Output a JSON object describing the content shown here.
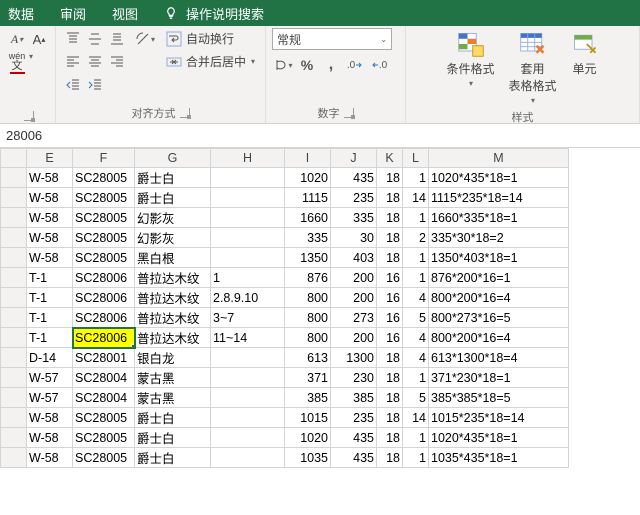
{
  "tabs": {
    "data": "数据",
    "review": "审阅",
    "view": "视图",
    "tell_me": "操作说明搜索"
  },
  "ribbon": {
    "font_size_caret": "▾",
    "btn_italic": "A",
    "btn_wen": "wén",
    "btn_wen_sub": "文",
    "wrap_label": "自动换行",
    "merge_label": "合并后居中",
    "align_group": "对齐方式",
    "number_format": "常规",
    "number_group": "数字",
    "cond_fmt": "条件格式",
    "table_fmt": "套用\n表格格式",
    "cell_style": "单元",
    "styles_group": "样式"
  },
  "formula_bar_value": "28006",
  "columns": [
    "E",
    "F",
    "G",
    "H",
    "I",
    "J",
    "K",
    "L",
    "M"
  ],
  "rows": [
    {
      "e": "W-58",
      "f": "SC28005",
      "g": "爵士白",
      "h": "",
      "i": "1020",
      "j": "435",
      "k": "18",
      "l": "1",
      "m": "1020*435*18=1"
    },
    {
      "e": "W-58",
      "f": "SC28005",
      "g": "爵士白",
      "h": "",
      "i": "1115",
      "j": "235",
      "k": "18",
      "l": "14",
      "m": "1115*235*18=14"
    },
    {
      "e": "W-58",
      "f": "SC28005",
      "g": "幻影灰",
      "h": "",
      "i": "1660",
      "j": "335",
      "k": "18",
      "l": "1",
      "m": "1660*335*18=1"
    },
    {
      "e": "W-58",
      "f": "SC28005",
      "g": "幻影灰",
      "h": "",
      "i": "335",
      "j": "30",
      "k": "18",
      "l": "2",
      "m": "335*30*18=2"
    },
    {
      "e": "W-58",
      "f": "SC28005",
      "g": "黑白根",
      "h": "",
      "i": "1350",
      "j": "403",
      "k": "18",
      "l": "1",
      "m": "1350*403*18=1"
    },
    {
      "e": "T-1",
      "f": "SC28006",
      "g": "普拉达木纹",
      "h": "1",
      "i": "876",
      "j": "200",
      "k": "16",
      "l": "1",
      "m": "876*200*16=1"
    },
    {
      "e": "T-1",
      "f": "SC28006",
      "g": "普拉达木纹",
      "h": "2.8.9.10",
      "i": "800",
      "j": "200",
      "k": "16",
      "l": "4",
      "m": "800*200*16=4"
    },
    {
      "e": "T-1",
      "f": "SC28006",
      "g": "普拉达木纹",
      "h": "3~7",
      "i": "800",
      "j": "273",
      "k": "16",
      "l": "5",
      "m": "800*273*16=5"
    },
    {
      "e": "T-1",
      "f": "SC28006",
      "g": "普拉达木纹",
      "h": "11~14",
      "i": "800",
      "j": "200",
      "k": "16",
      "l": "4",
      "m": "800*200*16=4",
      "hl": true,
      "active": true
    },
    {
      "e": "D-14",
      "f": "SC28001",
      "g": "银白龙",
      "h": "",
      "i": "613",
      "j": "1300",
      "k": "18",
      "l": "4",
      "m": "613*1300*18=4"
    },
    {
      "e": "W-57",
      "f": "SC28004",
      "g": "蒙古黑",
      "h": "",
      "i": "371",
      "j": "230",
      "k": "18",
      "l": "1",
      "m": "371*230*18=1"
    },
    {
      "e": "W-57",
      "f": "SC28004",
      "g": "蒙古黑",
      "h": "",
      "i": "385",
      "j": "385",
      "k": "18",
      "l": "5",
      "m": "385*385*18=5"
    },
    {
      "e": "W-58",
      "f": "SC28005",
      "g": "爵士白",
      "h": "",
      "i": "1015",
      "j": "235",
      "k": "18",
      "l": "14",
      "m": "1015*235*18=14"
    },
    {
      "e": "W-58",
      "f": "SC28005",
      "g": "爵士白",
      "h": "",
      "i": "1020",
      "j": "435",
      "k": "18",
      "l": "1",
      "m": "1020*435*18=1"
    },
    {
      "e": "W-58",
      "f": "SC28005",
      "g": "爵士白",
      "h": "",
      "i": "1035",
      "j": "435",
      "k": "18",
      "l": "1",
      "m": "1035*435*18=1"
    }
  ]
}
